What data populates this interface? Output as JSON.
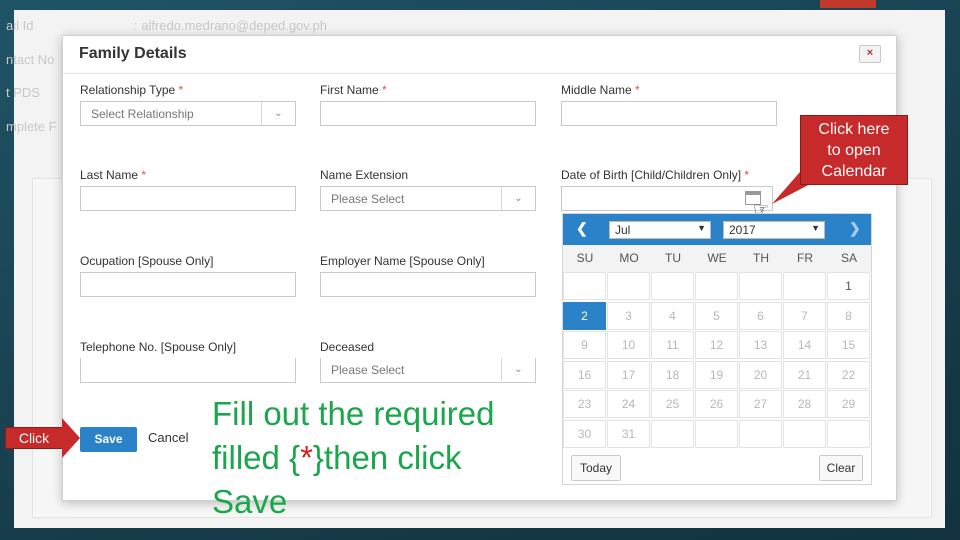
{
  "background": {
    "labels": [
      "ail Id",
      "ntact No",
      "t PDS",
      "mplete F"
    ],
    "email": ":   alfredo.medrano@deped.gov.ph"
  },
  "modal": {
    "title": "Family Details",
    "close": "×",
    "fields": {
      "relationship_type": {
        "label": "Relationship Type",
        "placeholder": "Select Relationship",
        "required": "*"
      },
      "first_name": {
        "label": "First Name",
        "value": "",
        "required": "*"
      },
      "middle_name": {
        "label": "Middle Name",
        "value": "",
        "required": "*"
      },
      "last_name": {
        "label": "Last Name",
        "value": "",
        "required": "*"
      },
      "name_extension": {
        "label": "Name Extension",
        "placeholder": "Please Select"
      },
      "date_of_birth": {
        "label": "Date of Birth [Child/Children Only]",
        "value": "",
        "required": "*"
      },
      "occupation": {
        "label": "Ocupation [Spouse Only]",
        "value": ""
      },
      "employer_name": {
        "label": "Employer Name [Spouse Only]",
        "value": ""
      },
      "telephone": {
        "label": "Telephone No. [Spouse Only]",
        "value": ""
      },
      "deceased": {
        "label": "Deceased",
        "placeholder": "Please Select"
      }
    },
    "buttons": {
      "save": "Save",
      "cancel": "Cancel"
    }
  },
  "calendar": {
    "month": "Jul",
    "year": "2017",
    "prev_icon": "chevron-left-icon",
    "next_icon": "chevron-right-icon",
    "weekdays": [
      "SU",
      "MO",
      "TU",
      "WE",
      "TH",
      "FR",
      "SA"
    ],
    "weeks": [
      [
        "",
        "",
        "",
        "",
        "",
        "",
        "1"
      ],
      [
        "2",
        "3",
        "4",
        "5",
        "6",
        "7",
        "8"
      ],
      [
        "9",
        "10",
        "11",
        "12",
        "13",
        "14",
        "15"
      ],
      [
        "16",
        "17",
        "18",
        "19",
        "20",
        "21",
        "22"
      ],
      [
        "23",
        "24",
        "25",
        "26",
        "27",
        "28",
        "29"
      ],
      [
        "30",
        "31",
        "",
        "",
        "",
        "",
        ""
      ]
    ],
    "selected_day": "2",
    "today_label": "Today",
    "clear_label": "Clear"
  },
  "annotations": {
    "click": "Click",
    "calendar_line1": "Click here",
    "calendar_line2": "to open",
    "calendar_line3": "Calendar",
    "instruction_part1": "Fill out the required filled {",
    "instruction_star": "*",
    "instruction_part2": "}then click Save"
  },
  "colors": {
    "accent_blue": "#2a82c9",
    "callout_red": "#c62a2a",
    "instruction_green": "#1aa64b",
    "required_red": "#d9534f"
  }
}
